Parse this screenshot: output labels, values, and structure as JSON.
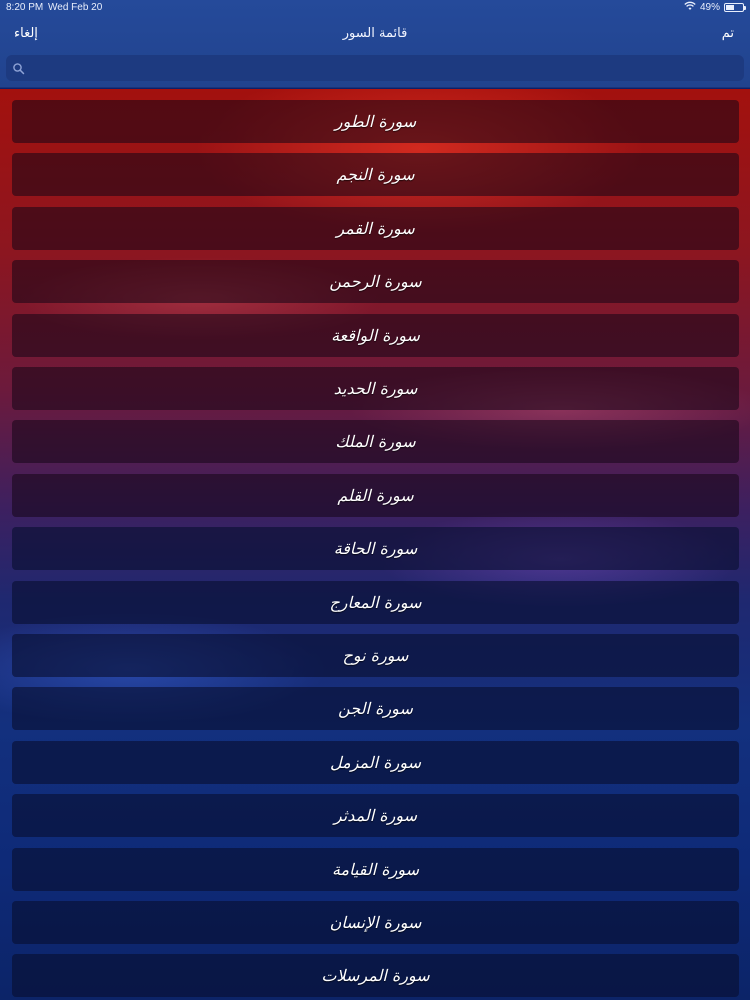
{
  "status": {
    "time": "8:20 PM",
    "date": "Wed Feb 20",
    "battery_percent": "49%",
    "battery_level": 0.49,
    "wifi_icon": "wifi-icon"
  },
  "nav": {
    "cancel_label": "إلغاء",
    "title": "قائمة السور",
    "done_label": "تم"
  },
  "search": {
    "placeholder": "",
    "value": "",
    "icon": "search-icon"
  },
  "colors": {
    "top_red": "#a3110e",
    "bottom_blue": "#0c2468",
    "bar_blue": "#254a9a"
  },
  "surahs": [
    "سورة الطور",
    "سورة النجم",
    "سورة القمر",
    "سورة الرحمن",
    "سورة الواقعة",
    "سورة الحديد",
    "سورة الملك",
    "سورة القلم",
    "سورة الحاقة",
    "سورة المعارج",
    "سورة نوح",
    "سورة الجن",
    "سورة المزمل",
    "سورة المدثر",
    "سورة القيامة",
    "سورة الإنسان",
    "سورة المرسلات"
  ]
}
